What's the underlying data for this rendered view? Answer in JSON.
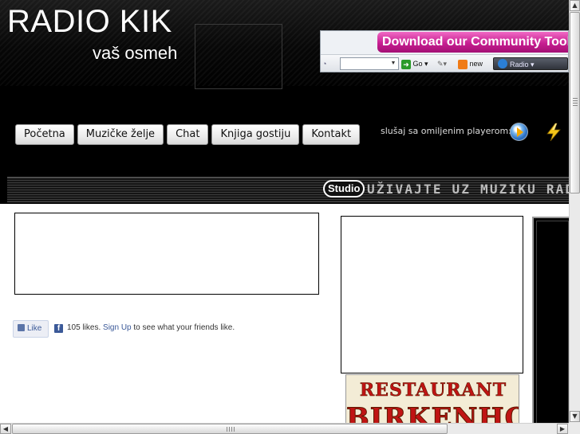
{
  "header": {
    "title": "RADIO KIK",
    "subtitle": "vaš osmeh"
  },
  "toolbar_ad": {
    "banner_text": "Download our Community Toolbar",
    "go_label": "Go",
    "new_label": "new",
    "radio_label": "Radio",
    "search_value": ""
  },
  "nav": {
    "items": [
      {
        "label": "Početna"
      },
      {
        "label": "Muzičke želje"
      },
      {
        "label": "Chat"
      },
      {
        "label": "Knjiga gostiju"
      },
      {
        "label": "Kontakt"
      }
    ]
  },
  "player": {
    "text": "slušaj sa omiljenim playerom:",
    "icons": [
      "media-player-icon",
      "winamp-icon"
    ]
  },
  "marquee": {
    "logo": "Studio",
    "text": "UŽIVAJTE UZ MUZIKU RADIO KIK"
  },
  "facebook": {
    "like_label": "Like",
    "f_letter": "f",
    "likes": "105 likes.",
    "signup": "Sign Up",
    "suffix": "to see what your friends like."
  },
  "restaurant_ad": {
    "line1": "RESTAURANT",
    "line2": "BIRKENHOF"
  },
  "colors": {
    "header_bg": "#000000",
    "ad_banner": "#c71e91",
    "restaurant_text": "#c01414",
    "facebook_blue": "#3b5998"
  }
}
